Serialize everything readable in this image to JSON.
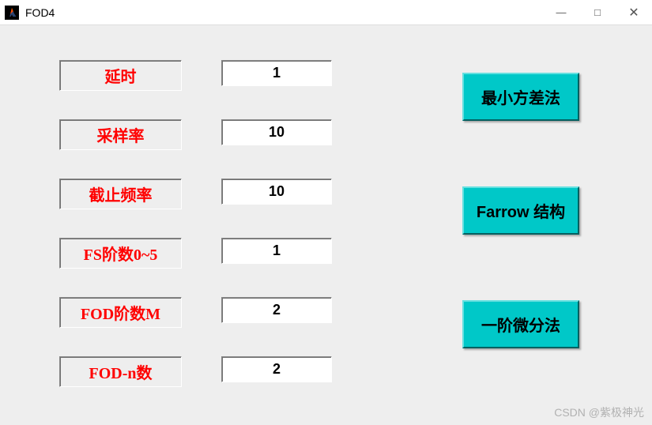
{
  "window": {
    "title": "FOD4"
  },
  "params": {
    "delay": {
      "label": "延时",
      "value": "1"
    },
    "sample_rate": {
      "label": "采样率",
      "value": "10"
    },
    "cutoff_freq": {
      "label": "截止频率",
      "value": "10"
    },
    "fs_order": {
      "label": "FS阶数0~5",
      "value": "1"
    },
    "fod_order_m": {
      "label": "FOD阶数M",
      "value": "2"
    },
    "fod_n": {
      "label": "FOD-n数",
      "value": "2"
    }
  },
  "buttons": {
    "min_variance": "最小方差法",
    "farrow": "Farrow 结构",
    "first_order_diff": "一阶微分法"
  },
  "watermark": "CSDN @紫极神光"
}
